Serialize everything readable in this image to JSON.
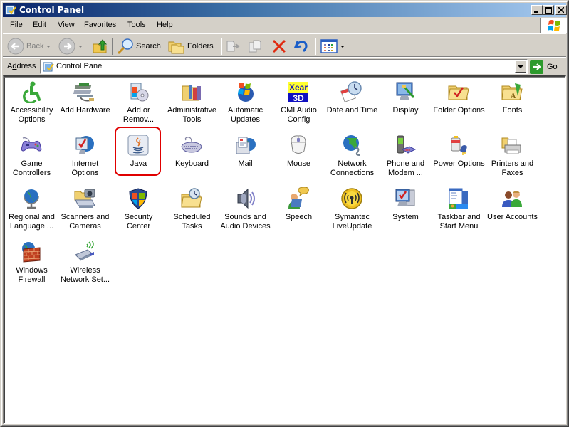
{
  "window": {
    "title": "Control Panel",
    "caption_buttons": {
      "minimize": "_",
      "maximize": "□",
      "close": "X"
    }
  },
  "menubar": {
    "items": [
      {
        "label": "File",
        "accel": "F"
      },
      {
        "label": "Edit",
        "accel": "E"
      },
      {
        "label": "View",
        "accel": "V"
      },
      {
        "label": "Favorites",
        "accel": "a"
      },
      {
        "label": "Tools",
        "accel": "T"
      },
      {
        "label": "Help",
        "accel": "H"
      }
    ]
  },
  "toolbar": {
    "back_label": "Back",
    "search_label": "Search",
    "folders_label": "Folders",
    "icons": [
      "back-icon",
      "forward-icon",
      "up-folder-icon",
      "search-icon",
      "folders-icon",
      "move-to-icon",
      "copy-to-icon",
      "delete-icon",
      "undo-icon",
      "views-icon"
    ]
  },
  "address": {
    "label": "Address",
    "value": "Control Panel",
    "go_label": "Go"
  },
  "highlight_color": "#e00000",
  "items": [
    {
      "line1": "Accessibility",
      "line2": "Options",
      "icon": "accessibility-icon"
    },
    {
      "line1": "Add Hardware",
      "line2": "",
      "icon": "add-hardware-icon"
    },
    {
      "line1": "Add or",
      "line2": "Remov...",
      "icon": "add-remove-programs-icon"
    },
    {
      "line1": "Administrative",
      "line2": "Tools",
      "icon": "administrative-tools-icon"
    },
    {
      "line1": "Automatic",
      "line2": "Updates",
      "icon": "automatic-updates-icon"
    },
    {
      "line1": "CMI Audio",
      "line2": "Config",
      "icon": "cmi-audio-icon",
      "badge_top": "Xear",
      "badge_bottom": "3D"
    },
    {
      "line1": "Date and Time",
      "line2": "",
      "icon": "date-time-icon"
    },
    {
      "line1": "Display",
      "line2": "",
      "icon": "display-icon"
    },
    {
      "line1": "Folder Options",
      "line2": "",
      "icon": "folder-options-icon"
    },
    {
      "line1": "Fonts",
      "line2": "",
      "icon": "fonts-icon"
    },
    {
      "line1": "Game",
      "line2": "Controllers",
      "icon": "game-controllers-icon"
    },
    {
      "line1": "Internet",
      "line2": "Options",
      "icon": "internet-options-icon"
    },
    {
      "line1": "Java",
      "line2": "",
      "icon": "java-icon",
      "highlighted": true
    },
    {
      "line1": "Keyboard",
      "line2": "",
      "icon": "keyboard-icon"
    },
    {
      "line1": "Mail",
      "line2": "",
      "icon": "mail-icon"
    },
    {
      "line1": "Mouse",
      "line2": "",
      "icon": "mouse-icon"
    },
    {
      "line1": "Network",
      "line2": "Connections",
      "icon": "network-connections-icon"
    },
    {
      "line1": "Phone and",
      "line2": "Modem ...",
      "icon": "phone-modem-icon"
    },
    {
      "line1": "Power Options",
      "line2": "",
      "icon": "power-options-icon"
    },
    {
      "line1": "Printers and",
      "line2": "Faxes",
      "icon": "printers-faxes-icon"
    },
    {
      "line1": "Regional and",
      "line2": "Language ...",
      "icon": "regional-language-icon"
    },
    {
      "line1": "Scanners and",
      "line2": "Cameras",
      "icon": "scanners-cameras-icon"
    },
    {
      "line1": "Security",
      "line2": "Center",
      "icon": "security-center-icon"
    },
    {
      "line1": "Scheduled",
      "line2": "Tasks",
      "icon": "scheduled-tasks-icon"
    },
    {
      "line1": "Sounds and",
      "line2": "Audio Devices",
      "icon": "sounds-audio-icon"
    },
    {
      "line1": "Speech",
      "line2": "",
      "icon": "speech-icon"
    },
    {
      "line1": "Symantec",
      "line2": "LiveUpdate",
      "icon": "symantec-liveupdate-icon"
    },
    {
      "line1": "System",
      "line2": "",
      "icon": "system-icon"
    },
    {
      "line1": "Taskbar and",
      "line2": "Start Menu",
      "icon": "taskbar-start-menu-icon"
    },
    {
      "line1": "User Accounts",
      "line2": "",
      "icon": "user-accounts-icon"
    },
    {
      "line1": "Windows",
      "line2": "Firewall",
      "icon": "windows-firewall-icon"
    },
    {
      "line1": "Wireless",
      "line2": "Network Set...",
      "icon": "wireless-network-icon"
    }
  ]
}
